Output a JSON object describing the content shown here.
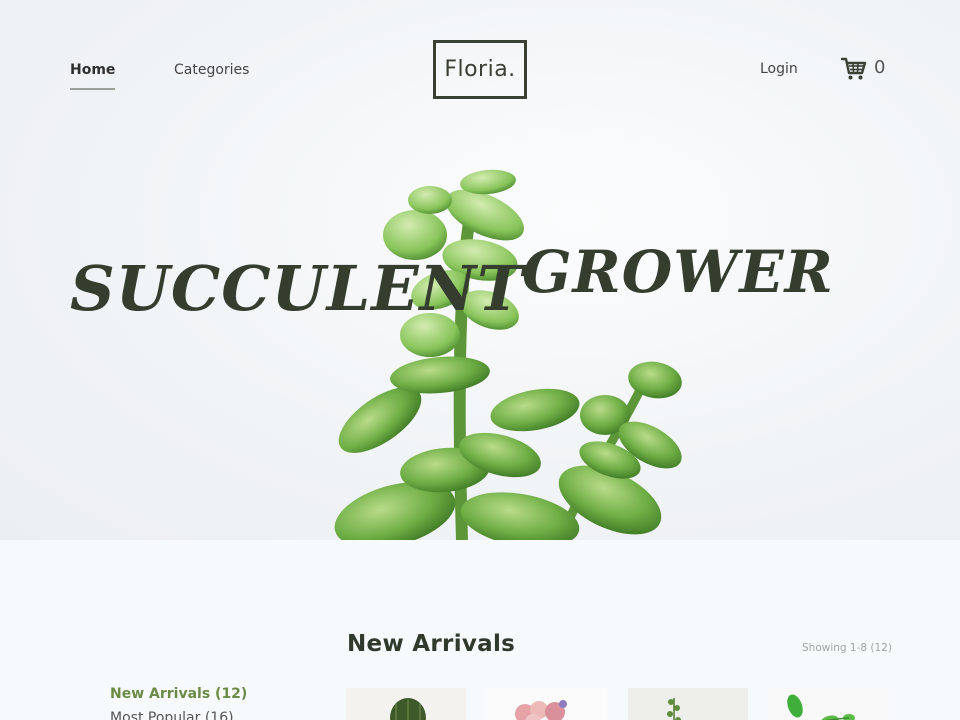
{
  "header": {
    "nav": [
      {
        "label": "Home",
        "active": true
      },
      {
        "label": "Categories",
        "active": false
      }
    ],
    "logo": "Floria.",
    "login_label": "Login",
    "cart_icon": "shopping-cart-icon",
    "cart_count": "0"
  },
  "hero": {
    "word_1": "SUCCULENT",
    "word_2": "GROWER"
  },
  "new_arrivals": {
    "title": "New Arrivals",
    "showing": "Showing 1-8 (12)"
  },
  "sidebar": {
    "filters": [
      {
        "label": "New Arrivals (12)",
        "active": true
      },
      {
        "label": "Most Popular (16)",
        "active": false
      }
    ]
  },
  "colors": {
    "accent": "#6b8a45",
    "text_dark": "#353d2e",
    "background": "#f7fafc"
  }
}
